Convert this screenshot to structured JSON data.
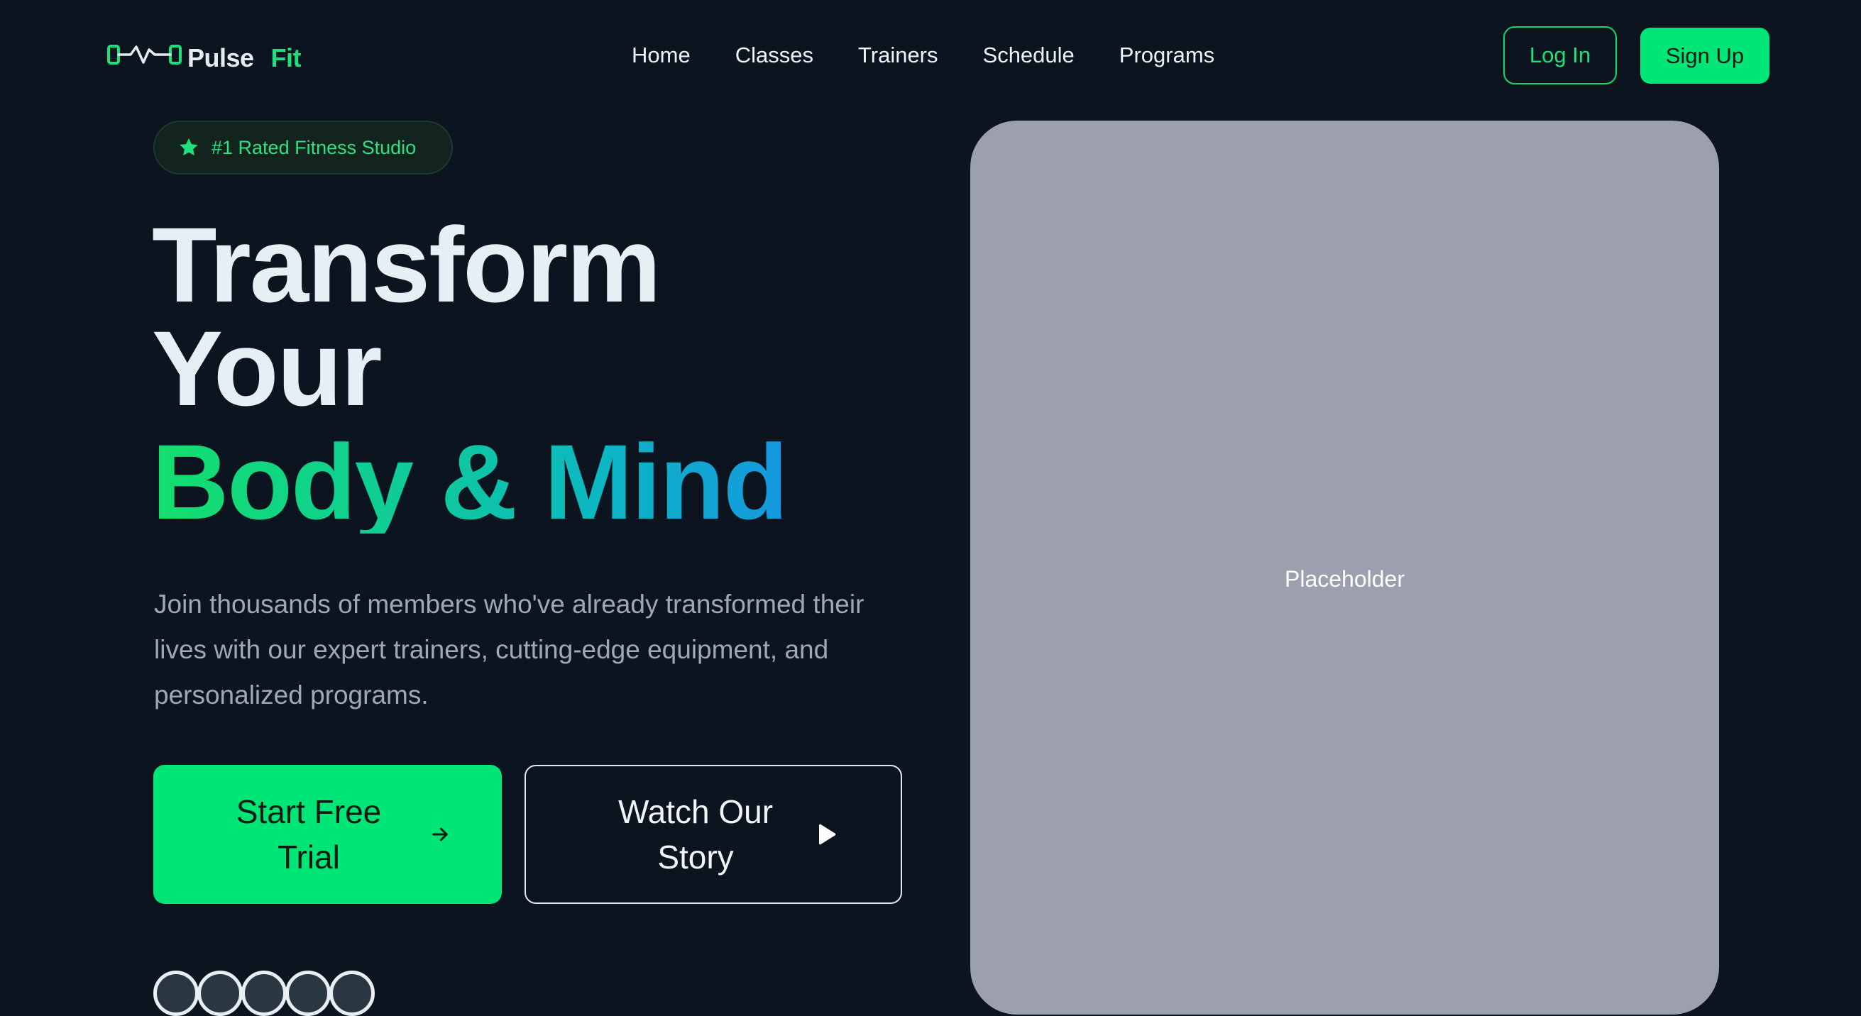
{
  "nav": {
    "brand": {
      "name_part1": "Pulse",
      "name_part2": "Fit",
      "icon": "dumbbell-heartbeat-icon"
    },
    "links": [
      {
        "label": "Home"
      },
      {
        "label": "Classes"
      },
      {
        "label": "Trainers"
      },
      {
        "label": "Schedule"
      },
      {
        "label": "Programs"
      }
    ],
    "login_label": "Log In",
    "signup_label": "Sign Up"
  },
  "hero": {
    "badge": {
      "icon": "star-icon",
      "text": "#1 Rated Fitness Studio"
    },
    "headline_line1": "Transform",
    "headline_line2": "Your",
    "headline_accent": "Body & Mind",
    "subtext": "Join thousands of members who've already transformed their lives with our expert trainers, cutting-edge equipment, and personalized programs.",
    "cta_primary": {
      "label": "Start Free Trial",
      "icon": "arrow-right-icon"
    },
    "cta_secondary": {
      "label": "Watch Our Story",
      "icon": "play-icon"
    },
    "media_placeholder": "Placeholder"
  },
  "colors": {
    "background": "#0c141f",
    "accent_green": "#00e676",
    "accent_gradient_end": "#1598e0",
    "text_primary": "#e7eef4",
    "text_muted": "#9ea9b7",
    "placeholder_bg": "#9c9fae"
  }
}
